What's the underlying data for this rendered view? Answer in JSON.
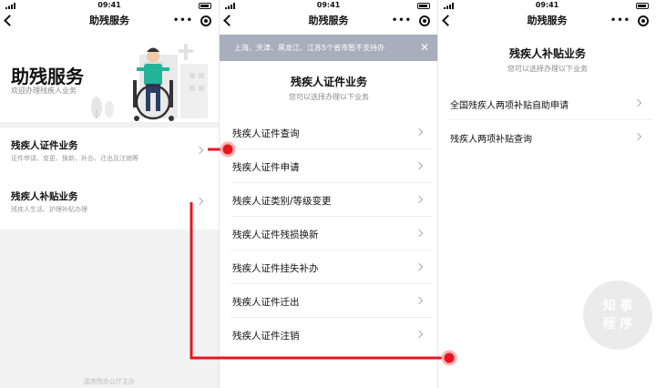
{
  "status_time": "09:41",
  "panel1": {
    "nav_title": "助残服务",
    "hero_title": "助残服务",
    "hero_subtitle": "欢迎办理残疾人业务",
    "cards": [
      {
        "title": "残疾人证件业务",
        "subtitle": "证件申请、变更、换新、补办、迁出及注销等"
      },
      {
        "title": "残疾人补贴业务",
        "subtitle": "残疾人生活、护理补贴办理"
      }
    ],
    "footer": "国务院办公厅主办"
  },
  "panel2": {
    "nav_title": "助残服务",
    "notice": "上海、天津、黑龙江、江苏5个省市暂不支持办",
    "section_title": "残疾人证件业务",
    "section_subtitle": "您可以选择办理以下业务",
    "items": [
      "残疾人证件查询",
      "残疾人证件申请",
      "残疾人证类别/等级变更",
      "残疾人证件残损换新",
      "残疾人证件挂失补办",
      "残疾人证件迁出",
      "残疾人证件注销"
    ]
  },
  "panel3": {
    "nav_title": "助残服务",
    "section_title": "残疾人补贴业务",
    "section_subtitle": "您可以选择办理以下业务",
    "items": [
      "全国残疾人两项补贴自助申请",
      "残疾人两项补贴查询"
    ],
    "watermark": "知 事\n程 序"
  },
  "colors": {
    "annotation_red": "#e8141f",
    "notice_bg": "#a8aebb"
  }
}
